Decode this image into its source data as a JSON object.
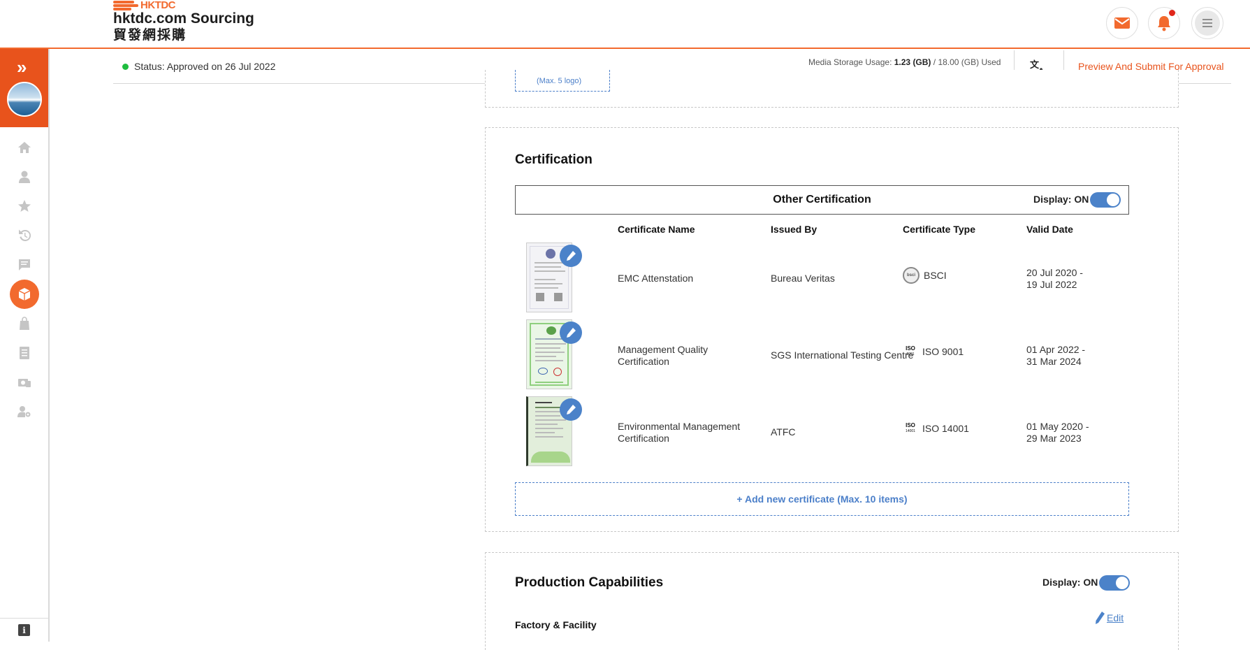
{
  "header": {
    "logo_brand": "HKTDC",
    "logo_title": "hktdc.com Sourcing",
    "logo_cn": "貿發網採購",
    "icons": [
      "mail-icon",
      "bell-icon",
      "menu-icon"
    ],
    "notification_dot": true
  },
  "sidebar": {
    "expand_icon": "double-chevron-right-icon",
    "items": [
      {
        "name": "home-icon",
        "active": false
      },
      {
        "name": "user-icon",
        "active": false
      },
      {
        "name": "star-icon",
        "active": false
      },
      {
        "name": "history-icon",
        "active": false
      },
      {
        "name": "chat-icon",
        "active": false
      },
      {
        "name": "product-box-icon",
        "active": true
      },
      {
        "name": "shopping-bag-icon",
        "active": false
      },
      {
        "name": "list-document-icon",
        "active": false
      },
      {
        "name": "camera-card-icon",
        "active": false
      },
      {
        "name": "user-settings-icon",
        "active": false
      }
    ],
    "info_label": "i"
  },
  "status": {
    "text": "Status: Approved on 26 Jul 2022",
    "storage_label": "Media Storage Usage: ",
    "storage_used": "1.23 (GB)",
    "storage_total": " / 18.00 (GB) Used",
    "preview_label": "Preview And Submit For Approval"
  },
  "prev_section": {
    "box_label": "(Max. 5 logo)"
  },
  "certification": {
    "title": "Certification",
    "box_title": "Other Certification",
    "display_label": "Display: ON",
    "columns": {
      "name": "Certificate Name",
      "issuer": "Issued By",
      "type": "Certificate Type",
      "valid": "Valid Date"
    },
    "rows": [
      {
        "name": "EMC Attenstation",
        "issuer": "Bureau Veritas",
        "type": "BSCI",
        "badge": "bsci",
        "valid_from": "20 Jul 2020 -",
        "valid_to": "19 Jul 2022"
      },
      {
        "name_l1": "Management Quality",
        "name_l2": "Certification",
        "issuer": "SGS International Testing Centre",
        "type": "ISO 9001",
        "badge": "iso",
        "valid_from": "01 Apr 2022 -",
        "valid_to": "31 Mar 2024"
      },
      {
        "name_l1": "Environmental Management",
        "name_l2": "Certification",
        "issuer": "ATFC",
        "type": "ISO 14001",
        "badge": "iso",
        "valid_from": "01 May 2020 -",
        "valid_to": "29 Mar 2023"
      }
    ],
    "add_label": "+ Add new certificate (Max. 10 items)"
  },
  "production": {
    "title": "Production Capabilities",
    "display_label": "Display: ON",
    "factory_label": "Factory & Facility",
    "edit_label": "Edit"
  },
  "colors": {
    "brand_orange": "#f26a2e",
    "accent_blue": "#4b82c9",
    "status_green": "#1fbd3f"
  }
}
